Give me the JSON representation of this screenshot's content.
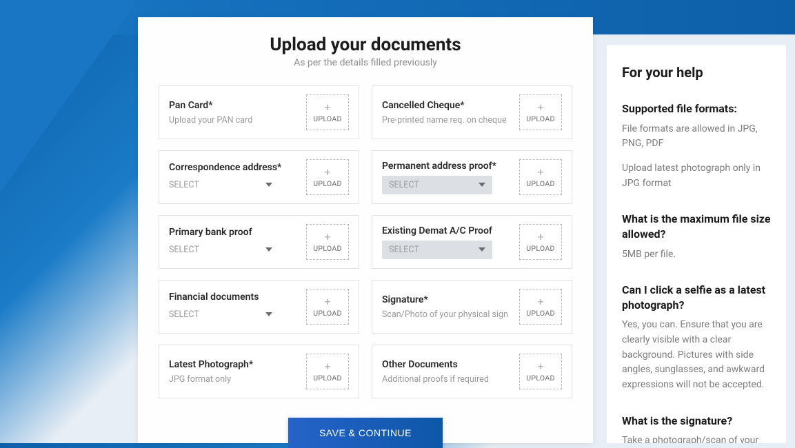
{
  "header": {
    "title": "Upload your documents",
    "subtitle": "As per the details filled previously"
  },
  "upload_button": {
    "label": "UPLOAD",
    "plus": "+"
  },
  "select": {
    "placeholder": "SELECT"
  },
  "documents": {
    "pan": {
      "label": "Pan Card*",
      "hint": "Upload your PAN card"
    },
    "cheque": {
      "label": "Cancelled Cheque*",
      "hint": "Pre-printed name req. on cheque"
    },
    "correspondence": {
      "label": "Correspondence address*"
    },
    "permanent": {
      "label": "Permanent address proof*"
    },
    "bank": {
      "label": "Primary bank proof"
    },
    "demat": {
      "label": "Existing Demat A/C Proof"
    },
    "financial": {
      "label": "Financial documents"
    },
    "signature": {
      "label": "Signature*",
      "hint": "Scan/Photo of your physical sign"
    },
    "photo": {
      "label": "Latest Photograph*",
      "hint": "JPG format only"
    },
    "other": {
      "label": "Other Documents",
      "hint": "Additional proofs if required"
    }
  },
  "save_button": "SAVE & CONTINUE",
  "help": {
    "title": "For your help",
    "sections": {
      "formats": {
        "q": "Supported file formats:",
        "a1": "File formats are allowed in JPG, PNG, PDF",
        "a2": "Upload latest photograph only in JPG format"
      },
      "size": {
        "q": "What is the maximum file size allowed?",
        "a": "5MB per file."
      },
      "selfie": {
        "q": "Can I click a selfie as a latest photograph?",
        "a": "Yes, you can. Ensure that you are clearly visible with a clear background. Pictures with side angles, sunglasses, and awkward expressions will not be accepted."
      },
      "signature": {
        "q": "What is the signature?",
        "a": "Take a photograph/scan of your"
      }
    }
  }
}
